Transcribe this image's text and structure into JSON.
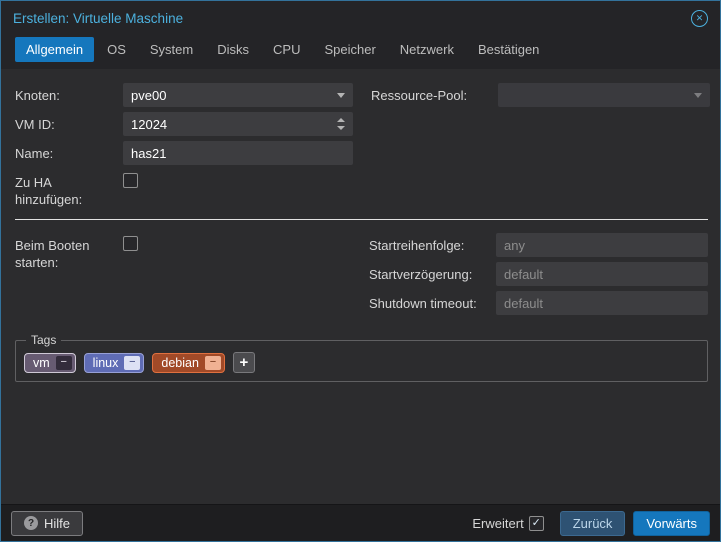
{
  "dialog": {
    "title": "Erstellen: Virtuelle Maschine"
  },
  "icons": {
    "close": "✕",
    "help": "?",
    "check": "✓",
    "minus": "−",
    "plus": "+"
  },
  "colors": {
    "accent": "#1577bd",
    "title": "#4cb1de",
    "panel": "#2c2c2e",
    "header": "#242427",
    "footer": "#1e1e20",
    "field": "#3d3d40",
    "placeholder": "#8d8d8d",
    "label": "#d6d6d6"
  },
  "tabs": [
    {
      "label": "Allgemein",
      "active": true
    },
    {
      "label": "OS",
      "active": false
    },
    {
      "label": "System",
      "active": false
    },
    {
      "label": "Disks",
      "active": false
    },
    {
      "label": "CPU",
      "active": false
    },
    {
      "label": "Speicher",
      "active": false
    },
    {
      "label": "Netzwerk",
      "active": false
    },
    {
      "label": "Bestätigen",
      "active": false
    }
  ],
  "form": {
    "fields": {
      "knoten": {
        "label": "Knoten:",
        "value": "pve00"
      },
      "pool": {
        "label": "Ressource-Pool:",
        "value": ""
      },
      "vmid": {
        "label": "VM ID:",
        "value": "12024"
      },
      "name": {
        "label": "Name:",
        "value": "has21"
      },
      "ha": {
        "label": "Zu HA hinzufügen:",
        "checked": false
      },
      "onboot": {
        "label": "Beim Booten starten:",
        "checked": false
      },
      "startorder": {
        "label": "Startreihenfolge:",
        "value": "",
        "placeholder": "any"
      },
      "startdelay": {
        "label": "Startverzögerung:",
        "value": "",
        "placeholder": "default"
      },
      "shutdown": {
        "label": "Shutdown timeout:",
        "value": "",
        "placeholder": "default"
      }
    },
    "tags": {
      "legend": "Tags",
      "items": [
        {
          "label": "vm",
          "bg": "#675b72",
          "border": "#cfc9d6",
          "fg": "#ffffff",
          "btn_bg": "#332c3b",
          "btn_fg": "#e9e5ee"
        },
        {
          "label": "linux",
          "bg": "#5f6cb5",
          "border": "#97a0d6",
          "fg": "#ffffff",
          "btn_bg": "#dde1f4",
          "btn_fg": "#39437c"
        },
        {
          "label": "debian",
          "bg": "#a14a28",
          "border": "#e0703f",
          "fg": "#ffffff",
          "btn_bg": "#f0b193",
          "btn_fg": "#6b2d10"
        }
      ]
    }
  },
  "footer": {
    "help_label": "Hilfe",
    "advanced_label": "Erweitert",
    "advanced_checked": true,
    "back_label": "Zurück",
    "forward_label": "Vorwärts"
  }
}
